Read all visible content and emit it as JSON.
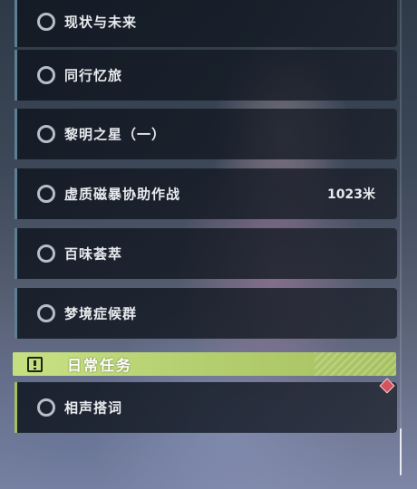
{
  "quests": [
    {
      "title": "现状与未来",
      "distance": ""
    },
    {
      "title": "同行忆旅",
      "distance": ""
    },
    {
      "title": "黎明之星（一）",
      "distance": ""
    },
    {
      "title": "虚质磁暴协助作战",
      "distance": "1023米"
    },
    {
      "title": "百味荟萃",
      "distance": ""
    },
    {
      "title": "梦境症候群",
      "distance": ""
    }
  ],
  "daily_section": {
    "title": "日常任务",
    "icon": "exclamation-icon",
    "accent_color": "#b5d070"
  },
  "daily_quests": [
    {
      "title": "相声搭词",
      "marker_icon": "diamond-marker-icon"
    }
  ],
  "colors": {
    "story_accent": "#5d7f93",
    "daily_accent": "#a3bf62",
    "marker": "#d4525a"
  }
}
